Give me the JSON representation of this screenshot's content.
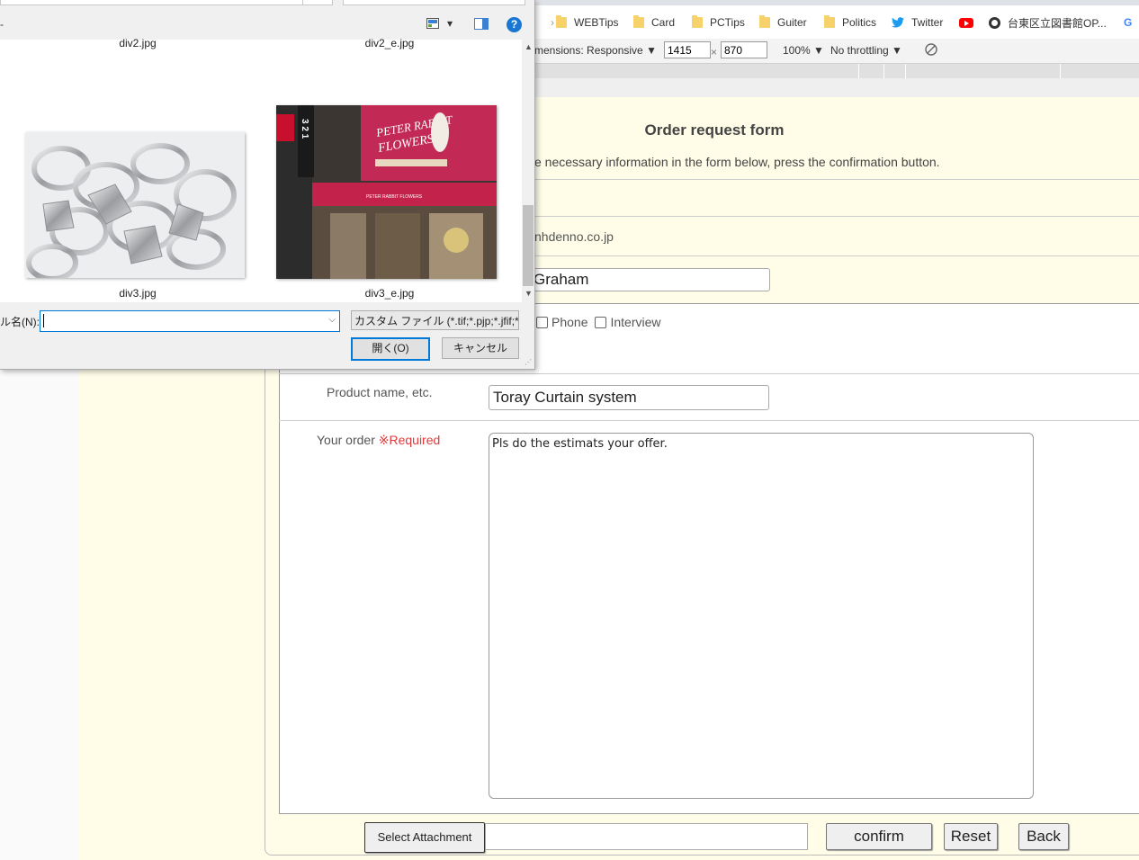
{
  "bookmarks": [
    {
      "label": "WEBTips",
      "icon": "folder-icon"
    },
    {
      "label": "Card",
      "icon": "folder-icon"
    },
    {
      "label": "PCTips",
      "icon": "folder-icon"
    },
    {
      "label": "Guiter",
      "icon": "folder-icon"
    },
    {
      "label": "Politics",
      "icon": "folder-icon"
    },
    {
      "label": "Twitter",
      "icon": "twitter-icon"
    },
    {
      "label": "",
      "icon": "youtube-icon"
    },
    {
      "label": "台東区立図書館OP...",
      "icon": "globe-icon"
    },
    {
      "label": "G",
      "icon": "google-icon"
    }
  ],
  "devtools": {
    "dimensions_label": "mensions: Responsive",
    "width": "1415",
    "height": "870",
    "x_sep": "×",
    "zoom": "100%",
    "throttling": "No throttling",
    "dropdown_caret": "▼"
  },
  "form": {
    "title": "Order request form",
    "instructions": "e necessary information in the form below, press the confirmation button.",
    "email_fragment": "nhdenno.co.jp",
    "name_value": "Graham",
    "contact_options": [
      "Phone",
      "Interview"
    ],
    "product_label": "Product name, etc.",
    "product_value": "Toray Curtain system",
    "order_label": "Your order",
    "required_mark": "※Required",
    "order_value": "Pls do the estimats your offer.",
    "attach_button": "Select Attachment",
    "confirm_button": "confirm",
    "reset_button": "Reset",
    "back_button": "Back"
  },
  "dialog": {
    "files": [
      {
        "name": "div2.jpg"
      },
      {
        "name": "div2_e.jpg"
      },
      {
        "name": "div3.jpg"
      },
      {
        "name": "div3_e.jpg"
      }
    ],
    "storefront_sign_line1": "PETER RABBIT",
    "storefront_sign_line2": "FLOWERS",
    "storefront_awning": "PETER RABBIT FLOWERS",
    "storefront_pillar": "3 2 1",
    "filename_label": "ル名(N):",
    "filename_value": "",
    "filter_value": "カスタム ファイル (*.tif;*.pjp;*.jfif;*.",
    "open_button": "開く(O)",
    "cancel_button": "キャンセル",
    "help_glyph": "?",
    "view_caret": "▾",
    "dialog_edge_glyph": "-"
  }
}
